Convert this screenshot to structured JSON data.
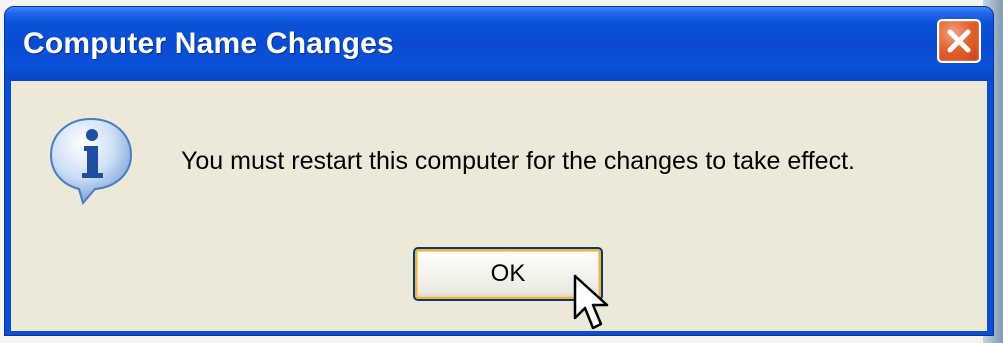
{
  "dialog": {
    "title": "Computer Name Changes",
    "message": "You must restart this computer for the changes to take effect.",
    "ok_label": "OK",
    "icon": "information-icon",
    "close_icon": "close-icon"
  },
  "colors": {
    "titlebar": "#0a4ed3",
    "client_background": "#ece9d8",
    "close_button": "#e2632f",
    "focus_ring": "#f8b243"
  }
}
